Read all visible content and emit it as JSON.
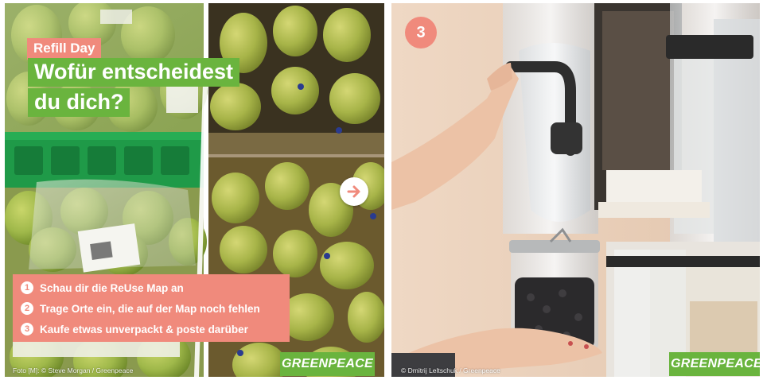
{
  "left_post": {
    "tag": "Refill Day",
    "headline_line1": "Wofür entscheidest",
    "headline_line2": "du dich?",
    "steps": [
      {
        "number": "1",
        "text": "Schau dir die ReUse Map an"
      },
      {
        "number": "2",
        "text": "Trage Orte ein, die auf der Map noch fehlen"
      },
      {
        "number": "3",
        "text": "Kaufe etwas unverpackt & poste darüber"
      }
    ],
    "next_icon": "arrow-right-icon",
    "logo": "GREENPEACE",
    "credit": "Foto [M]: © Steve Morgan / Greenpeace"
  },
  "right_post": {
    "page_number": "3",
    "logo": "GREENPEACE",
    "credit": "© Dmitrij Leltschuk / Greenpeace"
  },
  "colors": {
    "coral": "#f08a7c",
    "greenpeace_green": "#6ab43e",
    "pear_green": "#9fb84a",
    "crate_green": "#1f9a48"
  }
}
